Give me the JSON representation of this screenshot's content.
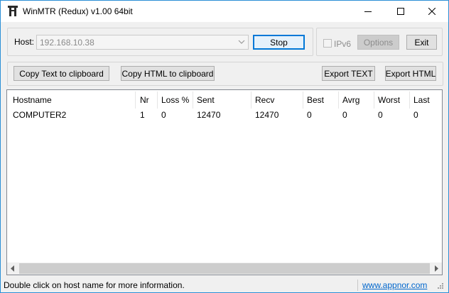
{
  "window": {
    "title": "WinMTR (Redux) v1.00 64bit",
    "accent": "#0078d7"
  },
  "host": {
    "label": "Host:",
    "value": "192.168.10.38"
  },
  "buttons": {
    "stop": "Stop",
    "options": "Options",
    "exit": "Exit",
    "copy_text": "Copy Text to clipboard",
    "copy_html": "Copy HTML to clipboard",
    "export_text": "Export TEXT",
    "export_html": "Export HTML"
  },
  "ipv6": {
    "label": "IPv6",
    "checked": false,
    "enabled": false
  },
  "table": {
    "columns": [
      "Hostname",
      "Nr",
      "Loss %",
      "Sent",
      "Recv",
      "Best",
      "Avrg",
      "Worst",
      "Last"
    ],
    "rows": [
      [
        "COMPUTER2",
        "1",
        "0",
        "12470",
        "12470",
        "0",
        "0",
        "0",
        "0"
      ]
    ]
  },
  "status": {
    "message": "Double click on host name for more information.",
    "link": "www.appnor.com"
  },
  "icons": {
    "app": "winmtr-app-icon",
    "minimize": "minimize-icon",
    "maximize": "maximize-icon",
    "close": "close-icon",
    "dropdown": "chevron-down-icon",
    "scroll_left": "scroll-left-icon",
    "scroll_right": "scroll-right-icon",
    "resize": "resize-grip-icon"
  }
}
